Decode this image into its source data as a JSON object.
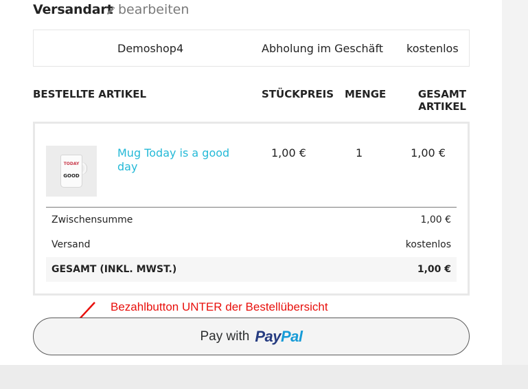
{
  "shipping_section": {
    "title": "Versandart",
    "edit_label": "bearbeiten",
    "carrier": {
      "name": "Demoshop4",
      "description": "Abholung im Geschäft",
      "price": "kostenlos"
    }
  },
  "order_table": {
    "headers": {
      "items": "BESTELLTE ARTIKEL",
      "unit_price": "STÜCKPREIS",
      "quantity": "MENGE",
      "total_line1": "GESAMT",
      "total_line2": "ARTIKEL"
    },
    "product": {
      "name": "Mug Today is a good day",
      "image_text_top": "TODAY",
      "image_text_bottom": "GOOD",
      "unit_price": "1,00 €",
      "quantity": "1",
      "total": "1,00 €"
    },
    "summary": {
      "subtotal_label": "Zwischensumme",
      "subtotal_value": "1,00 €",
      "shipping_label": "Versand",
      "shipping_value": "kostenlos",
      "total_label": "GESAMT (INKL. MWST.)",
      "total_value": "1,00 €"
    }
  },
  "annotation": {
    "text": "Bezahlbutton UNTER der Bestellübersicht",
    "color": "#e8100c"
  },
  "paypal_button": {
    "prefix": "Pay with",
    "brand_pay": "Pay",
    "brand_pal": "Pal",
    "brand_colors": {
      "pay": "#253b80",
      "pal": "#179bd7"
    }
  },
  "colors": {
    "link": "#24b9d7",
    "text": "#232323",
    "muted": "#7a7a7a"
  }
}
